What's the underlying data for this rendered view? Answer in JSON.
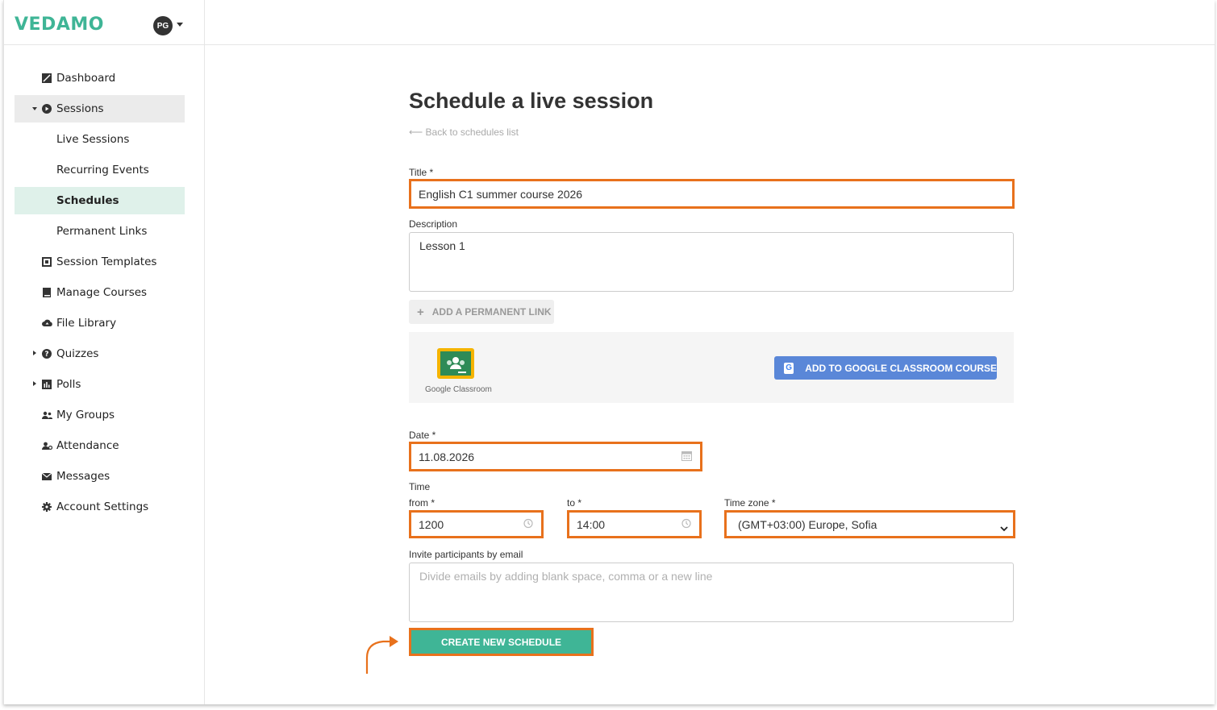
{
  "brand": {
    "logo_text": "VEDAMO",
    "accent": "#3fb596",
    "highlight": "#e8711c"
  },
  "user": {
    "initials": "PG"
  },
  "sidebar": {
    "items": [
      {
        "label": "Dashboard",
        "icon": "dashboard-icon"
      },
      {
        "label": "Sessions",
        "icon": "play-circle-icon"
      },
      {
        "label": "Live Sessions"
      },
      {
        "label": "Recurring Events"
      },
      {
        "label": "Schedules"
      },
      {
        "label": "Permanent Links"
      },
      {
        "label": "Session Templates",
        "icon": "template-icon"
      },
      {
        "label": "Manage Courses",
        "icon": "book-icon"
      },
      {
        "label": "File Library",
        "icon": "cloud-upload-icon"
      },
      {
        "label": "Quizzes",
        "icon": "question-circle-icon"
      },
      {
        "label": "Polls",
        "icon": "bar-chart-icon"
      },
      {
        "label": "My Groups",
        "icon": "users-icon"
      },
      {
        "label": "Attendance",
        "icon": "user-check-icon"
      },
      {
        "label": "Messages",
        "icon": "envelope-icon"
      },
      {
        "label": "Account Settings",
        "icon": "gear-icon"
      }
    ]
  },
  "main": {
    "title": "Schedule a live session",
    "back_link": "⟵ Back to schedules list",
    "title_label": "Title *",
    "title_value": "English C1 summer course 2026",
    "description_label": "Description",
    "description_value": "Lesson 1",
    "add_permanent_link": "ADD A PERMANENT LINK",
    "google_classroom_text": "Google Classroom",
    "add_google_classroom": "ADD TO GOOGLE CLASSROOM COURSE",
    "date_label": "Date *",
    "date_value": "11.08.2026",
    "time_label": "Time",
    "from_label": "from *",
    "from_value": "1200",
    "to_label": "to *",
    "to_value": "14:00",
    "timezone_label": "Time zone *",
    "timezone_value": "(GMT+03:00) Europe, Sofia",
    "invite_label": "Invite participants by email",
    "invite_placeholder": "Divide emails by adding blank space, comma or a new line",
    "create_button": "CREATE NEW SCHEDULE"
  }
}
